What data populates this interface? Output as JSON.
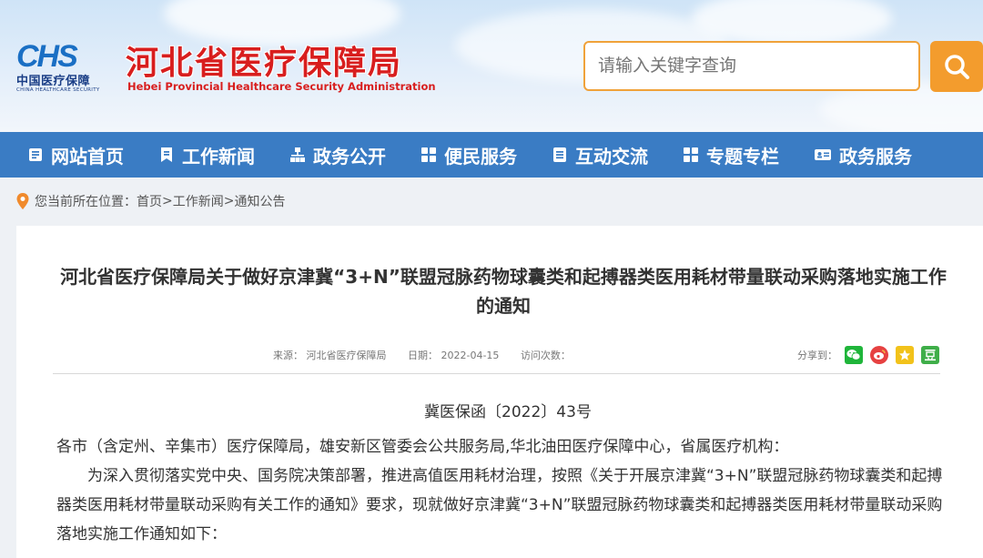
{
  "header": {
    "logo_mark": "CHS",
    "logo_cn": "中国医疗保障",
    "logo_en": "CHINA HEALTHCARE SECURITY",
    "site_title": "河北省医疗保障局",
    "site_subtitle": "Hebei Provincial Healthcare Security Administration",
    "search_placeholder": "请输入关键字查询"
  },
  "nav": [
    {
      "label": "网站首页",
      "icon": "document-icon"
    },
    {
      "label": "工作新闻",
      "icon": "bookmark-icon"
    },
    {
      "label": "政务公开",
      "icon": "org-chart-icon"
    },
    {
      "label": "便民服务",
      "icon": "grid-icon"
    },
    {
      "label": "互动交流",
      "icon": "list-icon"
    },
    {
      "label": "专题专栏",
      "icon": "grid-icon"
    },
    {
      "label": "政务服务",
      "icon": "id-card-icon"
    }
  ],
  "breadcrumb": {
    "prefix": "您当前所在位置：",
    "items": [
      "首页",
      "工作新闻",
      "通知公告"
    ],
    "separator": ">"
  },
  "article": {
    "title": "河北省医疗保障局关于做好京津冀“3+N”联盟冠脉药物球囊类和起搏器类医用耗材带量联动采购落地实施工作的通知",
    "source": "来源：  河北省医疗保障局",
    "date": "日期：  2022-04-15",
    "visits": "访问次数：",
    "share_label": "分享到：",
    "doc_number": "冀医保函〔2022〕43号",
    "paragraphs": [
      "各市（含定州、辛集市）医疗保障局，雄安新区管委会公共服务局,华北油田医疗保障中心，省属医疗机构：",
      "为深入贯彻落实党中央、国务院决策部署，推进高值医用耗材治理，按照《关于开展京津冀“3+N”联盟冠脉药物球囊类和起搏器类医用耗材带量联动采购有关工作的通知》要求，现就做好京津冀“3+N”联盟冠脉药物球囊类和起搏器类医用耗材带量联动采购落地实施工作通知如下："
    ]
  },
  "colors": {
    "nav_bg": "#3a7cc4",
    "title_red": "#d81e1e",
    "search_orange": "#f39c2d",
    "logo_blue": "#1a6fc4"
  }
}
